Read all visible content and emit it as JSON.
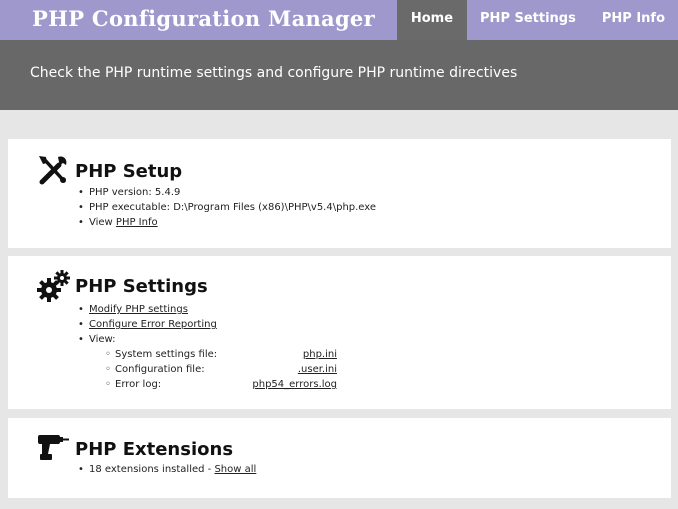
{
  "header": {
    "title": "PHP Configuration Manager",
    "tabs": [
      {
        "label": "Home",
        "active": true
      },
      {
        "label": "PHP Settings",
        "active": false
      },
      {
        "label": "PHP Info",
        "active": false
      }
    ]
  },
  "banner": {
    "text": "Check the PHP runtime settings and configure PHP runtime directives"
  },
  "setup": {
    "title": "PHP Setup",
    "icon": "tools-icon",
    "version_text": "PHP version: 5.4.9",
    "executable_text": "PHP executable: D:\\Program Files (x86)\\PHP\\v5.4\\php.exe",
    "view_prefix": "View ",
    "view_link": "PHP Info"
  },
  "settings": {
    "title": "PHP Settings",
    "icon": "gears-icon",
    "modify_link": "Modify PHP settings",
    "error_link": "Configure Error Reporting",
    "view_label": "View:",
    "files": [
      {
        "label": "System settings file:",
        "value": "php.ini"
      },
      {
        "label": "Configuration file:",
        "value": ".user.ini"
      },
      {
        "label": "Error log:",
        "value": "php54_errors.log"
      }
    ]
  },
  "extensions": {
    "title": "PHP Extensions",
    "icon": "drill-icon",
    "installed_text": "18 extensions installed - ",
    "show_all_link": "Show all"
  },
  "colors": {
    "header_bg": "#9e98cc",
    "active_tab_bg": "#6a6a6a",
    "banner_bg": "#686868",
    "page_bg": "#e6e6e6",
    "panel_bg": "#ffffff"
  }
}
